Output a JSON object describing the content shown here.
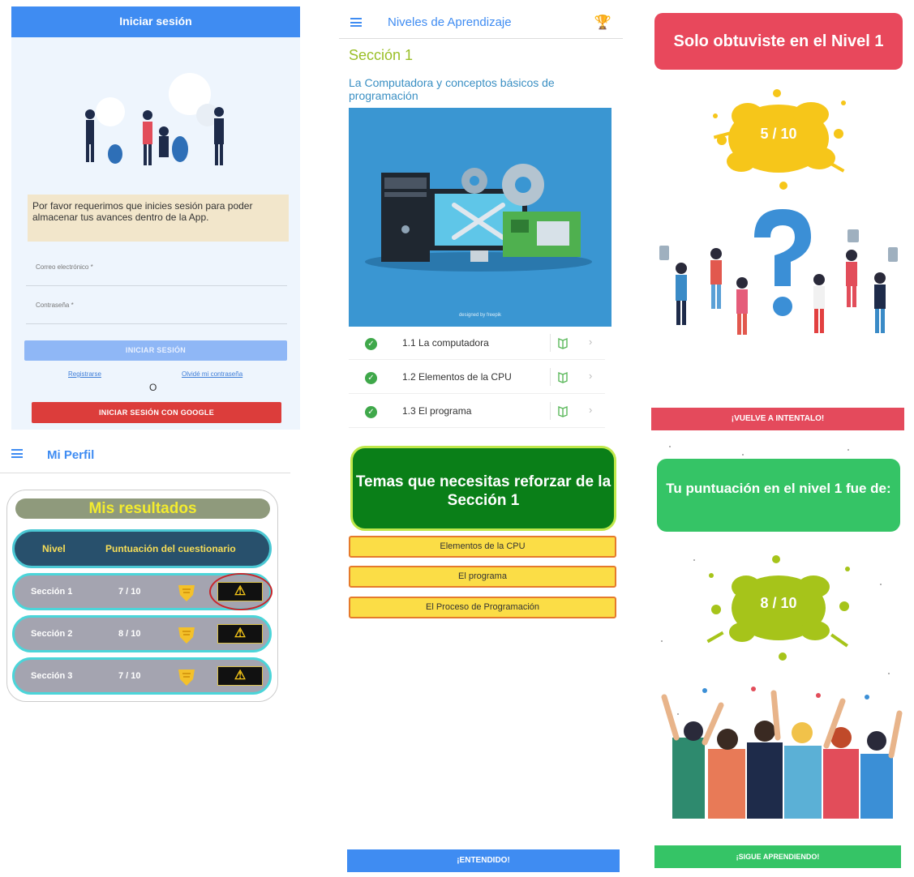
{
  "login": {
    "header": "Iniciar sesión",
    "notice": "Por favor requerimos que inicies sesión para poder almacenar tus avances dentro de la App.",
    "email_placeholder": "Correo electrónico *",
    "password_placeholder": "Contraseña *",
    "login_button": "INICIAR SESIÓN",
    "register_link": "Registrarse",
    "forgot_link": "Olvidé mi contraseña",
    "or": "O",
    "google_button": "INICIAR SESIÓN CON GOOGLE"
  },
  "niveles": {
    "title": "Niveles de Aprendizaje",
    "section": "Sección 1",
    "subtitle": "La Computadora y conceptos básicos de programación",
    "image_credit": "designed by freepik",
    "items": [
      {
        "label": "1.1 La computadora"
      },
      {
        "label": "1.2 Elementos de la CPU"
      },
      {
        "label": "1.3 El programa"
      }
    ]
  },
  "fail": {
    "header": "Solo obtuviste en el Nivel 1",
    "score": "5 / 10",
    "button": "¡VUELVE A INTENTALO!",
    "splash_color": "#f6c61a"
  },
  "perfil": {
    "title": "Mi Perfil",
    "card_title": "Mis resultados",
    "col_level": "Nivel",
    "col_score": "Puntuación del cuestionario",
    "rows": [
      {
        "section": "Sección 1",
        "score": "7 / 10"
      },
      {
        "section": "Sección 2",
        "score": "8 / 10"
      },
      {
        "section": "Sección 3",
        "score": "7 / 10"
      }
    ]
  },
  "temas": {
    "header": "Temas que necesitas reforzar de la Sección 1",
    "items": [
      "Elementos de la CPU",
      "El programa",
      "El Proceso de Programación"
    ],
    "button": "¡ENTENDIDO!"
  },
  "success": {
    "header": "Tu puntuación en el nivel 1 fue de:",
    "score": "8 / 10",
    "button": "¡SIGUE APRENDIENDO!",
    "splash_color": "#a6c41a"
  }
}
